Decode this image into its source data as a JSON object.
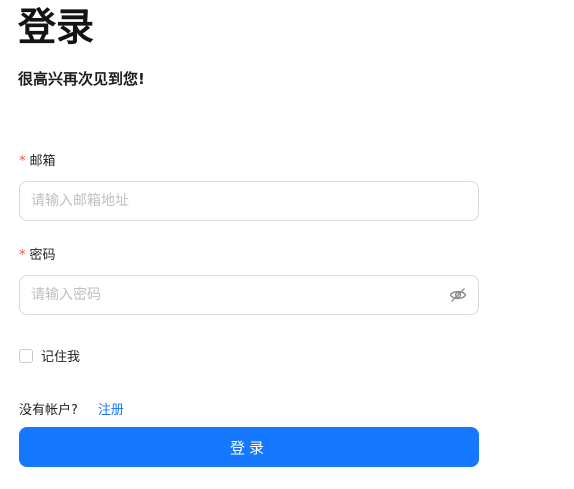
{
  "header": {
    "title": "登录",
    "subtitle": "很高兴再次见到您!"
  },
  "form": {
    "email": {
      "required_mark": "*",
      "label": "邮箱",
      "value": "",
      "placeholder": "请输入邮箱地址"
    },
    "password": {
      "required_mark": "*",
      "label": "密码",
      "value": "",
      "placeholder": "请输入密码",
      "toggle_icon": "eye-invisible-icon"
    },
    "remember": {
      "label": "记住我",
      "checked": false
    },
    "register_prompt": "没有帐户?",
    "register_link": "注册",
    "submit_label": "登录"
  },
  "colors": {
    "primary": "#1677ff",
    "required": "#ff4d4f",
    "border": "#d9d9d9",
    "placeholder": "#bfbfbf"
  }
}
